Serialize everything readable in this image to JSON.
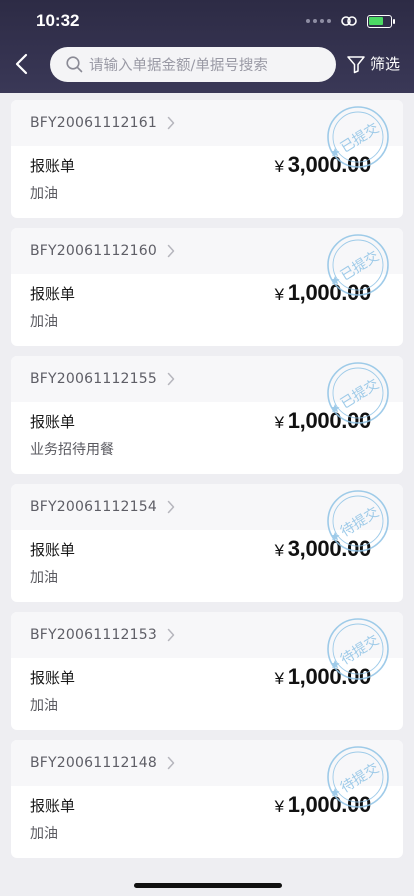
{
  "status": {
    "time": "10:32"
  },
  "nav": {
    "search_placeholder": "请输入单据金额/单据号搜索",
    "filter_label": "筛选"
  },
  "colors": {
    "header": "#2d2b45",
    "stamp": "#8fc3e6"
  },
  "bills": [
    {
      "code": "BFY20061112161",
      "type": "报账单",
      "desc": "加油",
      "currency": "¥",
      "amount": "3,000.00",
      "status": "已提交"
    },
    {
      "code": "BFY20061112160",
      "type": "报账单",
      "desc": "加油",
      "currency": "¥",
      "amount": "1,000.00",
      "status": "已提交"
    },
    {
      "code": "BFY20061112155",
      "type": "报账单",
      "desc": "业务招待用餐",
      "currency": "¥",
      "amount": "1,000.00",
      "status": "已提交"
    },
    {
      "code": "BFY20061112154",
      "type": "报账单",
      "desc": "加油",
      "currency": "¥",
      "amount": "3,000.00",
      "status": "待提交"
    },
    {
      "code": "BFY20061112153",
      "type": "报账单",
      "desc": "加油",
      "currency": "¥",
      "amount": "1,000.00",
      "status": "待提交"
    },
    {
      "code": "BFY20061112148",
      "type": "报账单",
      "desc": "加油",
      "currency": "¥",
      "amount": "1,000.00",
      "status": "待提交"
    }
  ]
}
